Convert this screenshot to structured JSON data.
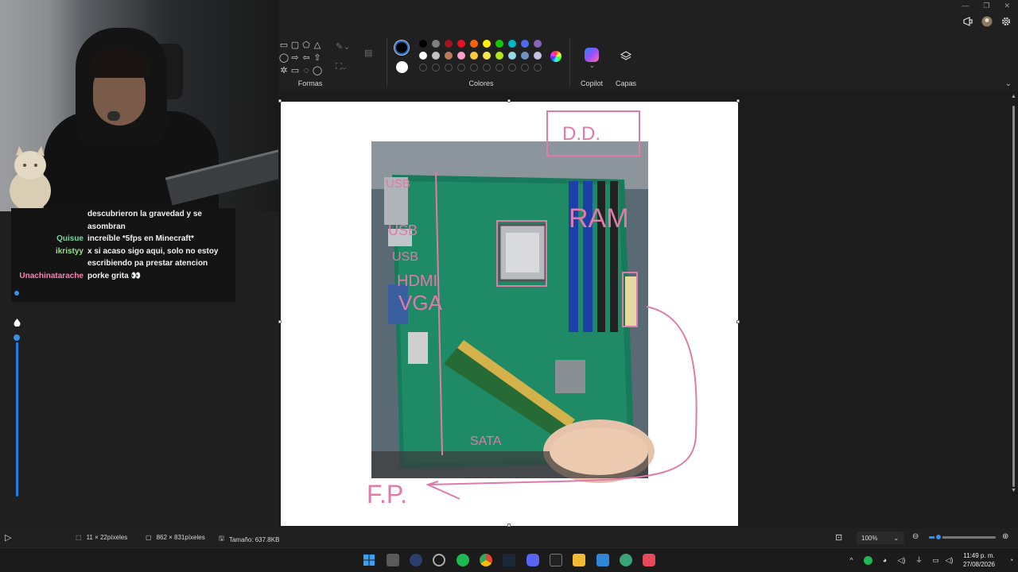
{
  "ribbon": {
    "shapes_label": "Formas",
    "colors_label": "Colores",
    "copilot_label": "Copilot",
    "layers_label": "Capas",
    "palette_row1": [
      "#000000",
      "#7f7f7f",
      "#a31621",
      "#e81123",
      "#f7630c",
      "#fff100",
      "#16c60c",
      "#00b7c3",
      "#4f6bed",
      "#8764b8"
    ],
    "palette_row2": [
      "#ffffff",
      "#c3c3c3",
      "#b97a57",
      "#ff9ec7",
      "#ffc83d",
      "#f7e54a",
      "#b5e61d",
      "#99d9ea",
      "#7092be",
      "#c8bfe7"
    ],
    "palette_row3_empty": 10
  },
  "chat": [
    {
      "user": "",
      "color": "#ffffff",
      "message": "descubrieron la gravedad y se asombran"
    },
    {
      "user": "Quisue",
      "color": "#7bd3a5",
      "message": "increíble *5fps en Minecraft*"
    },
    {
      "user": "ikristyy",
      "color": "#9ee08a",
      "message": "x si acaso sigo aqui, solo no estoy escribiendo pa prestar atencion"
    },
    {
      "user": "Unachinatarache",
      "color": "#ff7fb0",
      "message": "porke grita 👀"
    }
  ],
  "annotations": {
    "dd": "D.D.",
    "usb1": "USB",
    "usb2": "USB",
    "usb3": "USB",
    "hdmi": "HDMI",
    "vga": "VGA",
    "ram": "RAM",
    "sata": "SATA",
    "fp": "F.P."
  },
  "status": {
    "selection_size": "11 × 22píxeles",
    "image_size": "862 × 831píxeles",
    "file_size": "Tamaño: 637.8KB",
    "zoom": "100%",
    "zoom_fraction": 0.1
  },
  "taskbar": {
    "time": "11:49 p. m.",
    "date": "27/08/2026"
  }
}
